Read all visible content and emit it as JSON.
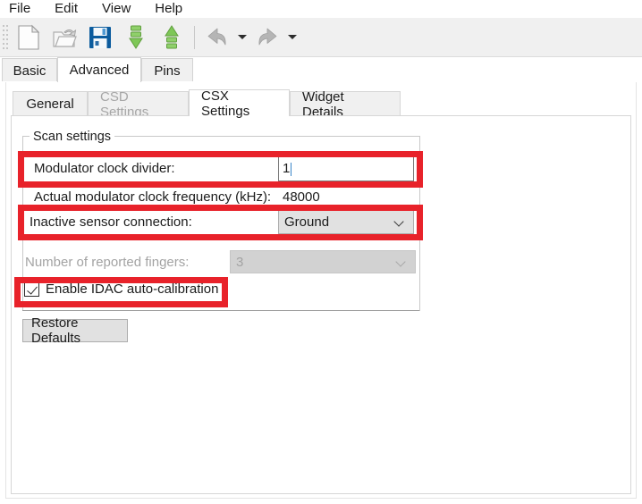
{
  "menu": {
    "items": [
      {
        "label": "File",
        "name": "menu-file"
      },
      {
        "label": "Edit",
        "name": "menu-edit"
      },
      {
        "label": "View",
        "name": "menu-view"
      },
      {
        "label": "Help",
        "name": "menu-help"
      }
    ]
  },
  "toolbar": {
    "buttons": [
      {
        "icon": "new-document-icon",
        "enabled": true
      },
      {
        "icon": "open-folder-icon",
        "enabled": false
      },
      {
        "icon": "save-floppy-icon",
        "enabled": true
      },
      {
        "icon": "import-down-arrow-icon",
        "enabled": true
      },
      {
        "icon": "export-up-arrow-icon",
        "enabled": true
      },
      {
        "icon": "undo-icon",
        "enabled": false
      },
      {
        "icon": "redo-icon",
        "enabled": false
      }
    ],
    "undo_caret": "chevron-down-icon",
    "redo_caret": "chevron-down-icon"
  },
  "outer_tabs": [
    {
      "label": "Basic",
      "selected": false,
      "disabled": false
    },
    {
      "label": "Advanced",
      "selected": true,
      "disabled": false
    },
    {
      "label": "Pins",
      "selected": false,
      "disabled": false
    }
  ],
  "inner_tabs": [
    {
      "label": "General",
      "selected": false,
      "disabled": false
    },
    {
      "label": "CSD Settings",
      "selected": false,
      "disabled": true
    },
    {
      "label": "CSX Settings",
      "selected": true,
      "disabled": false
    },
    {
      "label": "Widget Details",
      "selected": false,
      "disabled": false
    }
  ],
  "scan_settings": {
    "group_title": "Scan settings",
    "modulator_clock_divider": {
      "label": "Modulator clock divider:",
      "value": "1"
    },
    "actual_frequency": {
      "label": "Actual modulator clock frequency (kHz):",
      "value": "48000"
    },
    "inactive_sensor_connection": {
      "label": "Inactive sensor connection:",
      "value": "Ground"
    },
    "reported_fingers": {
      "label": "Number of reported fingers:",
      "value": "3",
      "disabled": true
    },
    "idac_auto_calibration": {
      "label": "Enable IDAC auto-calibration",
      "checked": true
    },
    "restore_defaults": {
      "label": "Restore Defaults"
    }
  },
  "highlights": {
    "color": "#e8222a",
    "boxes": [
      {
        "name": "highlight-modulator-clock-divider"
      },
      {
        "name": "highlight-inactive-sensor-connection"
      },
      {
        "name": "highlight-enable-idac-auto-calibration"
      }
    ]
  }
}
